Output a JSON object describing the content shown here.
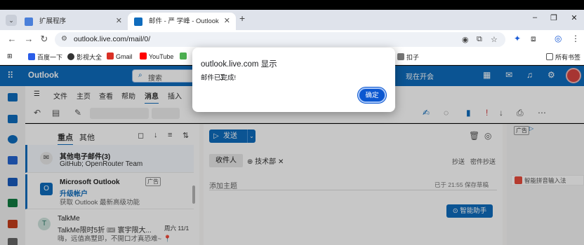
{
  "browser": {
    "tab_menu_icon": "chevron-down-icon",
    "tabs": [
      {
        "title": "扩展程序",
        "favicon_color": "#4a7fd9"
      },
      {
        "title": "邮件 - 严 学峰 - Outlook",
        "favicon_color": "#0f6cbd"
      }
    ],
    "new_tab": "+",
    "window_controls": [
      "–",
      "❐",
      "✕"
    ],
    "address": {
      "url": "outlook.live.com/mail/0/"
    },
    "bookmarks": [
      {
        "label": "百度一下",
        "color": "#2a5de8"
      },
      {
        "label": "影视大全",
        "color": "#333333"
      },
      {
        "label": "Gmail",
        "color": "#d93025"
      },
      {
        "label": "YouTube",
        "color": "#ff0000"
      },
      {
        "label": "扣子",
        "color": "#555555"
      }
    ],
    "all_bookmarks": "所有书签"
  },
  "outlook": {
    "app_name": "Outlook",
    "search_placeholder": "搜索",
    "meet_now": "现在开会",
    "ribbon_tabs": [
      "文件",
      "主页",
      "查看",
      "帮助",
      "消息",
      "插入"
    ],
    "active_ribbon_tab": "消息",
    "filter_tabs": {
      "focused": "重点",
      "other": "其他"
    },
    "mail_items": [
      {
        "sender": "其他电子邮件(3)",
        "line2": "GitHub; OpenRouter Team",
        "line3": ""
      },
      {
        "sender": "Microsoft Outlook",
        "badge": "广告",
        "line2": "升级帐户",
        "line3": "获取 Outlook 最新高级功能"
      },
      {
        "sender": "TalkMe",
        "line2": "TalkMe限时5折 🎟 寰宇限大...",
        "date": "周六 11/1",
        "line3": "嗨，远值高墅即，不開口才真恐难~ 📍"
      }
    ],
    "compose": {
      "send": "发送",
      "to": "收件人",
      "recipient": "技术部",
      "cc": "抄送",
      "bcc": "密件抄送",
      "subject_placeholder": "添加主题",
      "saved_status": "已于 21:55 保存草稿",
      "assistant": "智能助手"
    },
    "ad_tag": "广告",
    "ime_text": "智能拼音输入法"
  },
  "dialog": {
    "title": "outlook.live.com 显示",
    "message": "邮件已完成!",
    "ok": "确定"
  }
}
